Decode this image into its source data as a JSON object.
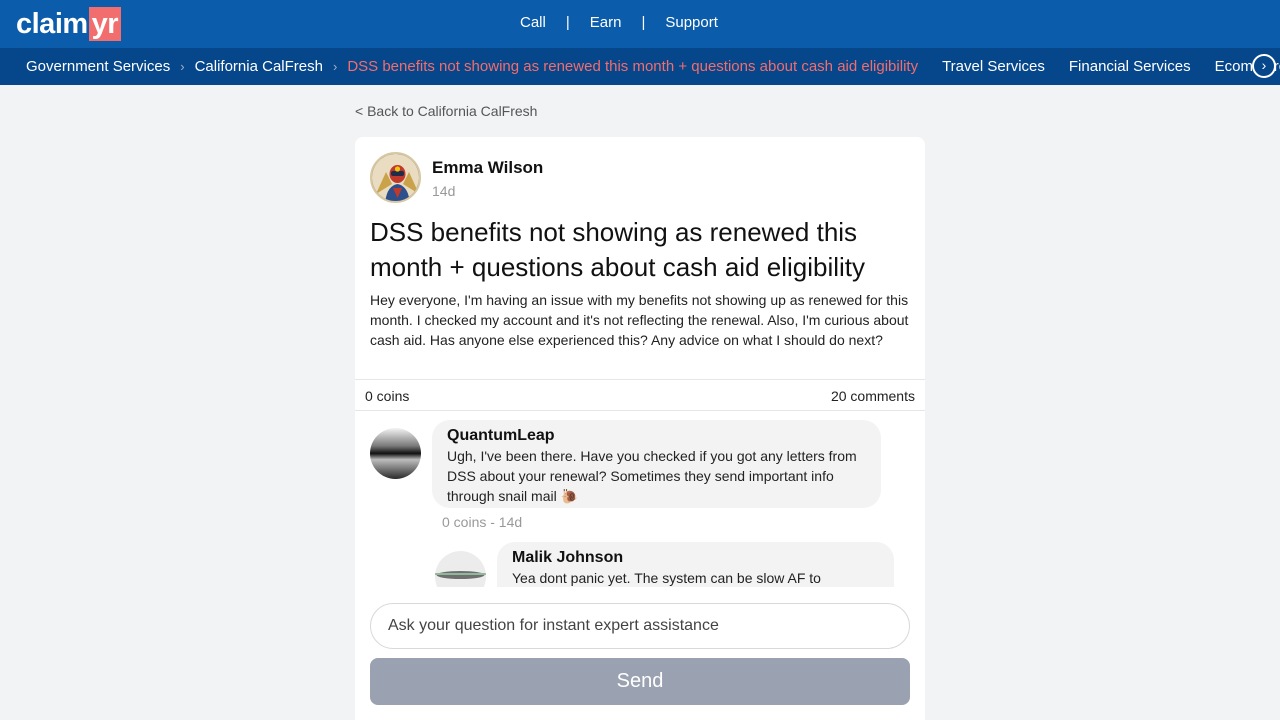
{
  "brand": {
    "logo_left": "claim",
    "logo_right": "yr"
  },
  "topnav": {
    "call": "Call",
    "earn": "Earn",
    "support": "Support",
    "separator": "|"
  },
  "breadcrumb": {
    "items": [
      "Government Services",
      "California CalFresh"
    ],
    "current": "DSS benefits not showing as renewed this month + questions about cash aid eligibility",
    "chevron": "›"
  },
  "categories": [
    "Travel Services",
    "Financial Services",
    "Ecommerce"
  ],
  "back_link": "< Back to California CalFresh",
  "post": {
    "author": "Emma Wilson",
    "time": "14d",
    "title": "DSS benefits not showing as renewed this month + questions about cash aid eligibility",
    "body": "Hey everyone, I'm having an issue with my benefits not showing up as renewed for this month. I checked my account and it's not reflecting the renewal. Also, I'm curious about cash aid. Has anyone else experienced this? Any advice on what I should do next?",
    "coins": "0 coins",
    "comments": "20 comments"
  },
  "comments": [
    {
      "author": "QuantumLeap",
      "text": "Ugh, I've been there. Have you checked if you got any letters from DSS about your renewal? Sometimes they send important info through snail mail 🐌",
      "meta": "0 coins - 14d"
    },
    {
      "author": "Malik Johnson",
      "text": "Yea dont panic yet. The system can be slow AF to"
    }
  ],
  "ask": {
    "placeholder": "Ask your question for instant expert assistance",
    "send_label": "Send"
  },
  "colors": {
    "header_bg": "#0b5cab",
    "subnav_bg": "#06468a",
    "accent": "#f26d6d",
    "send_disabled": "#9aa2b1",
    "page_bg": "#f2f3f5"
  },
  "icons": {
    "scroll_right": "chevron-right-icon"
  }
}
